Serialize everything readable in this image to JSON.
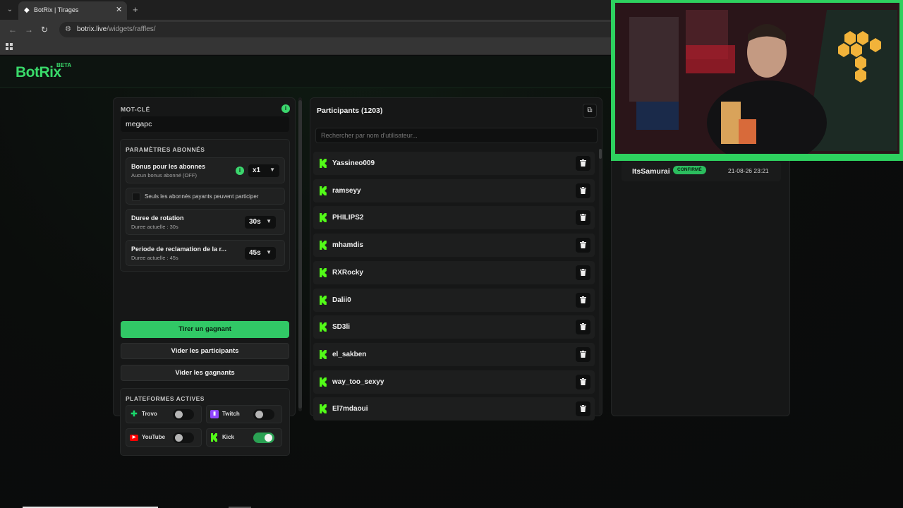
{
  "browser": {
    "tab_title": "BotRix | Tirages",
    "url_host": "botrix.live",
    "url_path": "/widgets/raffles/"
  },
  "header": {
    "logo": "BotRix",
    "beta": "BETA"
  },
  "left": {
    "keyword_title": "MOT-CLÉ",
    "keyword_value": "megapc",
    "subs_title": "PARAMÈTRES ABONNÉS",
    "bonus_title": "Bonus pour les abonnes",
    "bonus_sub": "Aucun bonus abonné (OFF)",
    "bonus_value": "x1",
    "paid_only_label": "Seuls les abonnés payants peuvent participer",
    "rotation_title": "Duree de rotation",
    "rotation_sub": "Duree actuelle : 30s",
    "rotation_value": "30s",
    "claim_title": "Periode de reclamation de la r...",
    "claim_sub": "Duree actuelle : 45s",
    "claim_value": "45s",
    "btn_draw": "Tirer un gagnant",
    "btn_clear_participants": "Vider les participants",
    "btn_clear_winners": "Vider les gagnants",
    "platforms_title": "PLATEFORMES ACTIVES",
    "platforms": [
      {
        "name": "Trovo",
        "enabled": false,
        "color": "#19d66b"
      },
      {
        "name": "Twitch",
        "enabled": false,
        "color": "#9146ff"
      },
      {
        "name": "YouTube",
        "enabled": false,
        "color": "#ff0000"
      },
      {
        "name": "Kick",
        "enabled": true,
        "color": "#53fc18"
      }
    ]
  },
  "participants": {
    "title": "Participants (1203)",
    "search_placeholder": "Rechercher par nom d'utilisateur...",
    "names": [
      "Yassineo009",
      "ramseyy",
      "PHILIPS2",
      "mhamdis",
      "RXRocky",
      "Dalii0",
      "SD3li",
      "el_sakben",
      "way_too_sexyy",
      "El7mdaoui"
    ]
  },
  "winners": {
    "name": "ItsSamurai",
    "status": "CONFIRMÉ",
    "date": "21-08-26 23:21"
  },
  "colors": {
    "accent": "#31c866",
    "kick": "#53fc18"
  }
}
